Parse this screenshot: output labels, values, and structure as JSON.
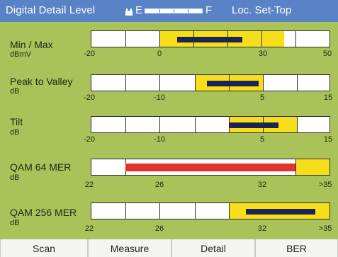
{
  "header": {
    "title": "Digital Detail Level",
    "battery_empty": "E",
    "battery_full": "F",
    "location": "Loc. Set-Top"
  },
  "meters": [
    {
      "label": "Min / Max",
      "unit": "dBmV",
      "ticks": [
        "-20",
        "0",
        "30",
        "50"
      ],
      "status": "pass"
    },
    {
      "label": "Peak to Valley",
      "unit": "dB",
      "ticks": [
        "-20",
        "-10",
        "5",
        "15"
      ],
      "status": "pass"
    },
    {
      "label": "Tilt",
      "unit": "dB",
      "ticks": [
        "-20",
        "-10",
        "5",
        "15"
      ],
      "status": "pass"
    },
    {
      "label": "QAM 64 MER",
      "unit": "dB",
      "ticks": [
        "22",
        "26",
        "32",
        ">35"
      ],
      "status": "fail"
    },
    {
      "label": "QAM 256 MER",
      "unit": "dB",
      "ticks": [
        "22",
        "26",
        "32",
        ">35"
      ],
      "status": "pass"
    }
  ],
  "softkeys": [
    "Scan",
    "Measure",
    "Detail",
    "BER"
  ],
  "colors": {
    "header_bg": "#5a82c6",
    "screen_bg": "#a9c35a",
    "limit_range": "#f6df1a",
    "measurement": "#1d2354",
    "alarm": "#e3332b"
  },
  "icons": {
    "battery": "battery-icon"
  }
}
